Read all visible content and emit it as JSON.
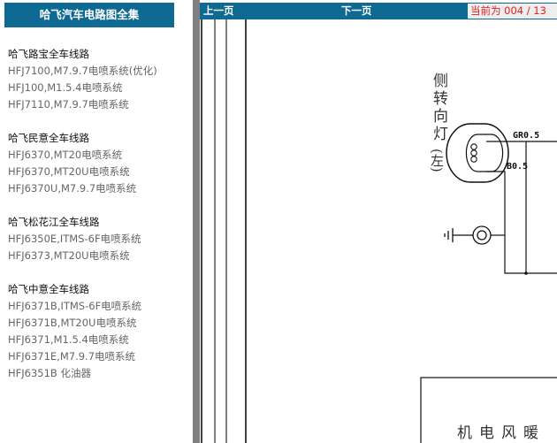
{
  "sidebar": {
    "title": "哈飞汽车电路图全集",
    "groups": [
      {
        "title": "哈飞路宝全车线路",
        "items": [
          "HFJ7100,M7.9.7电喷系统(优化)",
          "HFJ100,M1.5.4电喷系统",
          "HFJ7110,M7.9.7电喷系统"
        ]
      },
      {
        "title": "哈飞民意全车线路",
        "items": [
          "HFJ6370,MT20电喷系统",
          "HFJ6370,MT20U电喷系统",
          "HFJ6370U,M7.9.7电喷系统"
        ]
      },
      {
        "title": "哈飞松花江全车线路",
        "items": [
          "HFJ6350E,ITMS-6F电喷系统",
          "HFJ6373,MT20U电喷系统"
        ]
      },
      {
        "title": "哈飞中意全车线路",
        "items": [
          "HFJ6371B,ITMS-6F电喷系统",
          "HFJ6371B,MT20U电喷系统",
          "HFJ6371,M1.5.4电喷系统",
          "HFJ6371E,M7.9.7电喷系统",
          "HFJ6351B 化油器"
        ]
      }
    ]
  },
  "toolbar": {
    "prev_label": "上一页",
    "next_label": "下一页",
    "page_indicator": "当前为  004 / 13"
  },
  "diagram": {
    "lamp_label": "侧转向灯",
    "lamp_side": "(左)",
    "wire_labels": [
      "GR0.5",
      "B0.5"
    ],
    "box_columns": [
      "暖",
      "风",
      "电",
      "机"
    ]
  },
  "colors": {
    "title_bar": "#0f6a93",
    "splitter": "#7f7f7f",
    "indicator_text": "#e0211e",
    "link_text": "#666666"
  }
}
